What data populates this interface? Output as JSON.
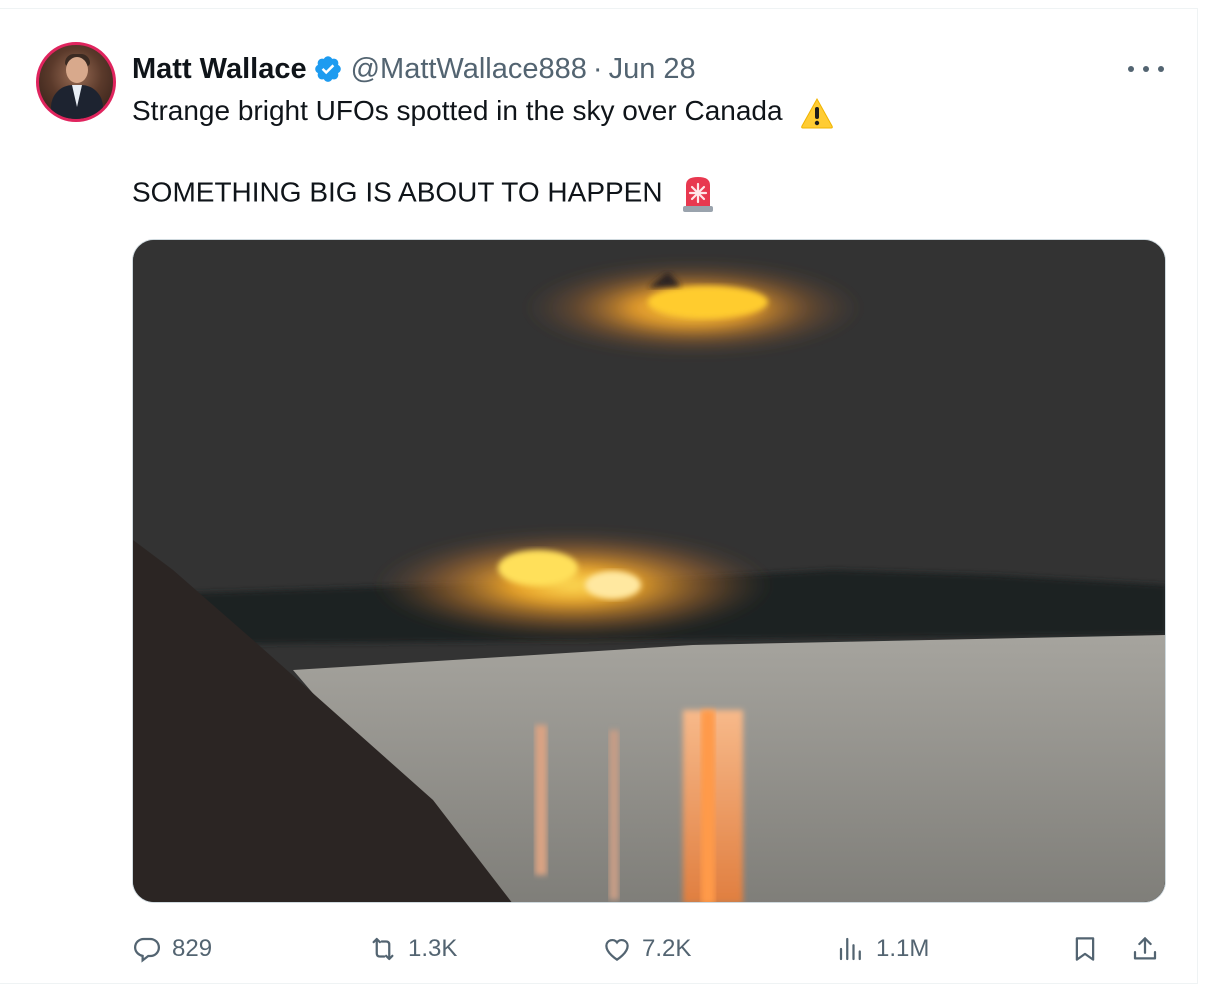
{
  "tweet": {
    "author": {
      "name": "Matt Wallace",
      "handle": "@MattWallace888",
      "separator": "·",
      "date": "Jun 28",
      "verified": true,
      "verified_color": "#1d9bf0",
      "avatar_ring_color": "#e0245e"
    },
    "text_line1": "Strange bright UFOs spotted in the sky over Canada",
    "emoji_line1": "warning-emoji",
    "text_line2": "SOMETHING BIG IS ABOUT TO HAPPEN",
    "emoji_line2": "rotating-light-emoji",
    "media": {
      "kind": "photo",
      "subject": "night sky with two glowing orange objects above water"
    },
    "stats": {
      "replies": "829",
      "reposts": "1.3K",
      "likes": "7.2K",
      "views": "1.1M"
    },
    "icons": {
      "reply": "reply-icon",
      "repost": "repost-icon",
      "like": "like-icon",
      "views": "views-icon",
      "bookmark": "bookmark-icon",
      "share": "share-icon",
      "more": "more-icon"
    },
    "colors": {
      "text_primary": "#0f1419",
      "text_secondary": "#536471",
      "border": "#eff3f4"
    }
  }
}
